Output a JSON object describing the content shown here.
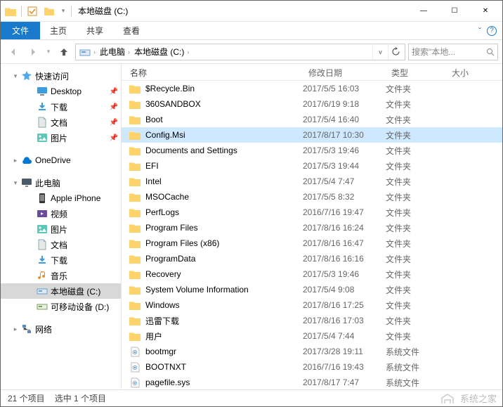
{
  "window": {
    "title": "本地磁盘 (C:)",
    "min": "—",
    "max": "☐",
    "close": "✕"
  },
  "ribbon": {
    "file": "文件",
    "home": "主页",
    "share": "共享",
    "view": "查看",
    "expand": "ˇ",
    "help": "?"
  },
  "nav": {
    "crumb1": "此电脑",
    "crumb2": "本地磁盘 (C:)",
    "search_placeholder": "搜索\"本地..."
  },
  "tree": {
    "quick": "快速访问",
    "desktop": "Desktop",
    "downloads": "下载",
    "documents": "文档",
    "pictures": "图片",
    "onedrive": "OneDrive",
    "thispc": "此电脑",
    "iphone": "Apple iPhone",
    "videos": "视频",
    "pictures2": "图片",
    "documents2": "文档",
    "downloads2": "下载",
    "music": "音乐",
    "cdrive": "本地磁盘 (C:)",
    "ddrive": "可移动设备 (D:)",
    "network": "网络"
  },
  "columns": {
    "name": "名称",
    "date": "修改日期",
    "type": "类型",
    "size": "大小"
  },
  "rows": [
    {
      "name": "$Recycle.Bin",
      "date": "2017/5/5 16:03",
      "type": "文件夹",
      "icon": "folder"
    },
    {
      "name": "360SANDBOX",
      "date": "2017/6/19 9:18",
      "type": "文件夹",
      "icon": "folder"
    },
    {
      "name": "Boot",
      "date": "2017/5/4 16:40",
      "type": "文件夹",
      "icon": "folder"
    },
    {
      "name": "Config.Msi",
      "date": "2017/8/17 10:30",
      "type": "文件夹",
      "icon": "folder",
      "sel": true
    },
    {
      "name": "Documents and Settings",
      "date": "2017/5/3 19:46",
      "type": "文件夹",
      "icon": "folder"
    },
    {
      "name": "EFI",
      "date": "2017/5/3 19:44",
      "type": "文件夹",
      "icon": "folder"
    },
    {
      "name": "Intel",
      "date": "2017/5/4 7:47",
      "type": "文件夹",
      "icon": "folder"
    },
    {
      "name": "MSOCache",
      "date": "2017/5/5 8:32",
      "type": "文件夹",
      "icon": "folder"
    },
    {
      "name": "PerfLogs",
      "date": "2016/7/16 19:47",
      "type": "文件夹",
      "icon": "folder"
    },
    {
      "name": "Program Files",
      "date": "2017/8/16 16:24",
      "type": "文件夹",
      "icon": "folder"
    },
    {
      "name": "Program Files (x86)",
      "date": "2017/8/16 16:47",
      "type": "文件夹",
      "icon": "folder"
    },
    {
      "name": "ProgramData",
      "date": "2017/8/16 16:16",
      "type": "文件夹",
      "icon": "folder"
    },
    {
      "name": "Recovery",
      "date": "2017/5/3 19:46",
      "type": "文件夹",
      "icon": "folder"
    },
    {
      "name": "System Volume Information",
      "date": "2017/5/4 9:08",
      "type": "文件夹",
      "icon": "folder"
    },
    {
      "name": "Windows",
      "date": "2017/8/16 17:25",
      "type": "文件夹",
      "icon": "folder"
    },
    {
      "name": "迅雷下载",
      "date": "2017/8/16 17:03",
      "type": "文件夹",
      "icon": "folder"
    },
    {
      "name": "用户",
      "date": "2017/5/4 7:44",
      "type": "文件夹",
      "icon": "folder"
    },
    {
      "name": "bootmgr",
      "date": "2017/3/28 19:11",
      "type": "系统文件",
      "icon": "file"
    },
    {
      "name": "BOOTNXT",
      "date": "2016/7/16 19:43",
      "type": "系统文件",
      "icon": "file"
    },
    {
      "name": "pagefile.sys",
      "date": "2017/8/17 7:47",
      "type": "系统文件",
      "icon": "file"
    }
  ],
  "status": {
    "count": "21 个项目",
    "selected": "选中 1 个项目"
  },
  "watermark": "系统之家"
}
